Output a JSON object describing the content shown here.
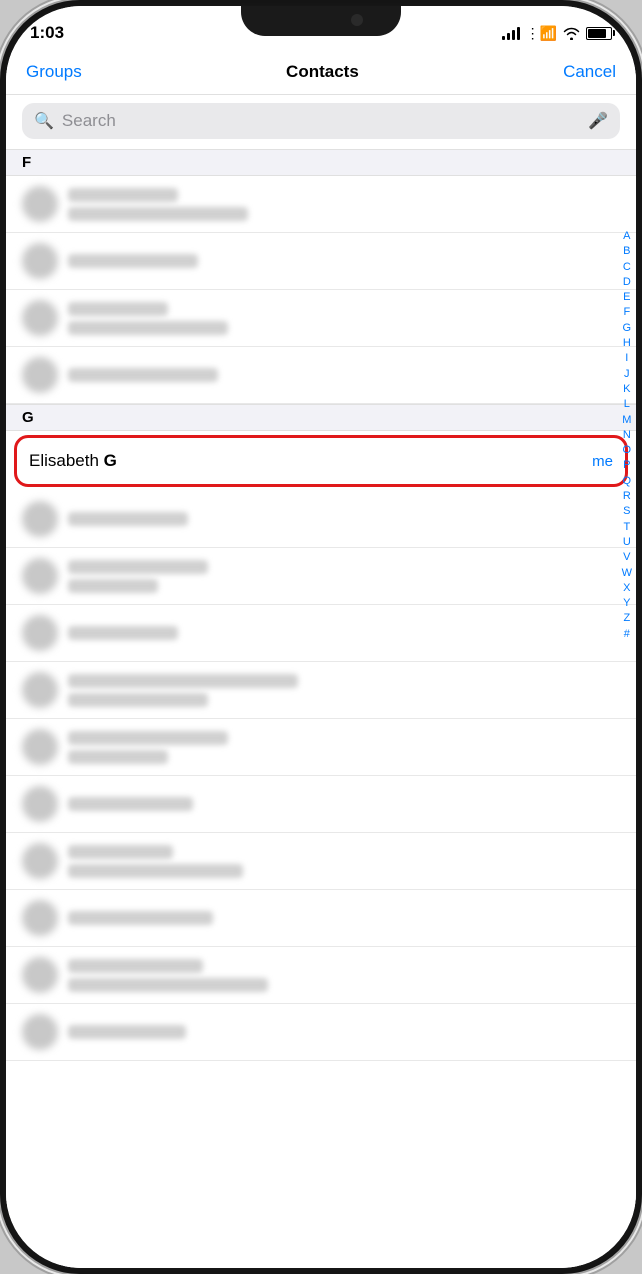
{
  "status_bar": {
    "time": "1:03",
    "signal_label": "signal",
    "wifi_label": "wifi",
    "battery_label": "battery"
  },
  "nav": {
    "groups_label": "Groups",
    "title": "Contacts",
    "cancel_label": "Cancel"
  },
  "search": {
    "placeholder": "Search",
    "mic_label": "microphone"
  },
  "sections": {
    "f_header": "F",
    "g_header": "G"
  },
  "highlighted_contact": {
    "first_name": "Elisabeth ",
    "last_name": "G",
    "tag": "me"
  },
  "alphabet": [
    "A",
    "B",
    "C",
    "D",
    "E",
    "F",
    "G",
    "H",
    "I",
    "J",
    "K",
    "L",
    "M",
    "N",
    "O",
    "P",
    "Q",
    "R",
    "S",
    "T",
    "U",
    "V",
    "W",
    "X",
    "Y",
    "Z",
    "#"
  ]
}
